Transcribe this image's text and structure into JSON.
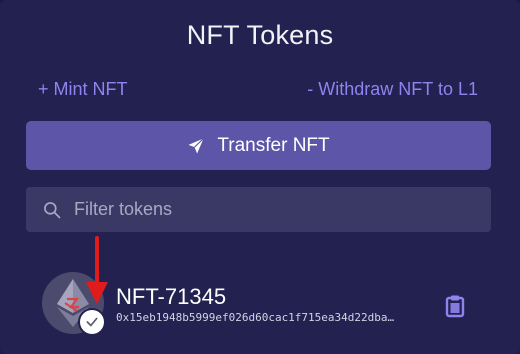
{
  "header": {
    "title": "NFT Tokens"
  },
  "actions": {
    "mint_label": "+ Mint NFT",
    "withdraw_label": "- Withdraw NFT to L1",
    "transfer_label": "Transfer NFT"
  },
  "search": {
    "placeholder": "Filter tokens",
    "value": ""
  },
  "tokens": [
    {
      "name": "NFT-71345",
      "address": "0x15eb1948b5999ef026d60cac1f715ea34d22dba…",
      "verified": true
    }
  ],
  "icons": {
    "transfer": "send-icon",
    "search": "search-icon",
    "copy": "clipboard-icon",
    "verified": "check-icon",
    "token": "ethereum-icon"
  },
  "colors": {
    "background": "#232150",
    "accent": "#8d84ee",
    "button": "#5d55a8",
    "input": "#3a3966",
    "annotation_arrow": "#e01b1b"
  }
}
